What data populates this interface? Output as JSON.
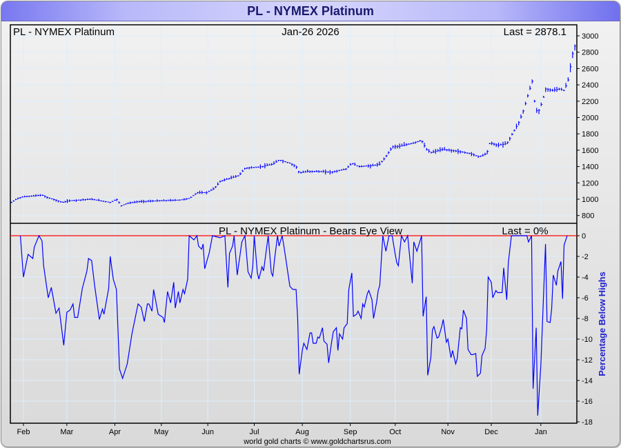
{
  "header": {
    "title": "PL  -  NYMEX Platinum"
  },
  "footer": {
    "credit": "world gold charts © www.goldchartsrus.com"
  },
  "colors": {
    "series": "#0000ff",
    "zero_line": "#ff0000",
    "grid": "#ddeeff",
    "ylabel": "#2222cc"
  },
  "chart_data": [
    {
      "type": "bar",
      "subtype": "ohlc",
      "title": "PL  -  NYMEX Platinum",
      "date_label": "Jan-26  2026",
      "last_label": "Last = 2878.1",
      "x_unit": "days since Feb 1 2025",
      "xlim": [
        -8.5,
        358
      ],
      "ylim": [
        700,
        3100
      ],
      "yticks": [
        800,
        1000,
        1200,
        1400,
        1600,
        1800,
        2000,
        2200,
        2400,
        2600,
        2800,
        3000
      ],
      "grid": true,
      "close_series": [
        [
          -8,
          960
        ],
        [
          -4,
          1010
        ],
        [
          0,
          1030
        ],
        [
          12,
          1050
        ],
        [
          14,
          1030
        ],
        [
          25,
          960
        ],
        [
          29,
          980
        ],
        [
          43,
          1000
        ],
        [
          47,
          990
        ],
        [
          56,
          960
        ],
        [
          60,
          1000
        ],
        [
          63,
          920
        ],
        [
          67,
          950
        ],
        [
          74,
          970
        ],
        [
          87,
          980
        ],
        [
          101,
          990
        ],
        [
          107,
          1010
        ],
        [
          112,
          1080
        ],
        [
          118,
          1080
        ],
        [
          123,
          1130
        ],
        [
          127,
          1220
        ],
        [
          132,
          1250
        ],
        [
          139,
          1290
        ],
        [
          143,
          1380
        ],
        [
          150,
          1390
        ],
        [
          154,
          1400
        ],
        [
          161,
          1430
        ],
        [
          165,
          1480
        ],
        [
          172,
          1440
        ],
        [
          176,
          1400
        ],
        [
          178,
          1320
        ],
        [
          183,
          1340
        ],
        [
          190,
          1340
        ],
        [
          199,
          1330
        ],
        [
          208,
          1370
        ],
        [
          212,
          1440
        ],
        [
          216,
          1400
        ],
        [
          225,
          1410
        ],
        [
          230,
          1430
        ],
        [
          233,
          1500
        ],
        [
          238,
          1640
        ],
        [
          243,
          1650
        ],
        [
          250,
          1680
        ],
        [
          257,
          1720
        ],
        [
          260,
          1610
        ],
        [
          263,
          1570
        ],
        [
          270,
          1610
        ],
        [
          279,
          1590
        ],
        [
          288,
          1560
        ],
        [
          294,
          1520
        ],
        [
          299,
          1560
        ],
        [
          301,
          1690
        ],
        [
          306,
          1660
        ],
        [
          312,
          1680
        ],
        [
          317,
          1850
        ],
        [
          320,
          1950
        ],
        [
          323,
          2100
        ],
        [
          326,
          2300
        ],
        [
          329,
          2480
        ],
        [
          330,
          2150
        ],
        [
          332,
          2050
        ],
        [
          335,
          2200
        ],
        [
          337,
          2350
        ],
        [
          341,
          2330
        ],
        [
          346,
          2350
        ],
        [
          349,
          2330
        ],
        [
          352,
          2480
        ],
        [
          354,
          2750
        ],
        [
          356,
          2878.1
        ]
      ]
    },
    {
      "type": "line",
      "title": "PL  -  NYMEX Platinum - Bears Eye View",
      "last_label": "Last = 0%",
      "ylabel": "Percentage Below Highs",
      "x_unit": "days since Feb 1 2025",
      "xlim": [
        -8.5,
        358
      ],
      "ylim": [
        -18,
        0
      ],
      "yticks": [
        0,
        -2,
        -4,
        -6,
        -8,
        -10,
        -12,
        -14,
        -16,
        -18
      ],
      "grid": true,
      "points": [
        [
          -2,
          0
        ],
        [
          0,
          -4.0
        ],
        [
          3,
          -1.8
        ],
        [
          6,
          -2.2
        ],
        [
          7,
          -1.1
        ],
        [
          10,
          0
        ],
        [
          12,
          -0.5
        ],
        [
          13,
          -2.9
        ],
        [
          16,
          -6.0
        ],
        [
          18,
          -5.0
        ],
        [
          21,
          -7.5
        ],
        [
          23,
          -7.0
        ],
        [
          26,
          -10.6
        ],
        [
          28,
          -7.4
        ],
        [
          30,
          -7.2
        ],
        [
          32,
          -6.6
        ],
        [
          33,
          -7.9
        ],
        [
          35,
          -7.9
        ],
        [
          38,
          -5.1
        ],
        [
          41,
          -3.4
        ],
        [
          42,
          -2.2
        ],
        [
          44,
          -2.4
        ],
        [
          46,
          -4.9
        ],
        [
          49,
          -8.1
        ],
        [
          51,
          -7.1
        ],
        [
          52,
          -7.6
        ],
        [
          55,
          -5.1
        ],
        [
          56,
          -2.0
        ],
        [
          58,
          -4.2
        ],
        [
          60,
          -5.2
        ],
        [
          62,
          -12.9
        ],
        [
          64,
          -13.8
        ],
        [
          67,
          -12.4
        ],
        [
          70,
          -9.5
        ],
        [
          74,
          -6.6
        ],
        [
          76,
          -6.9
        ],
        [
          78,
          -8.3
        ],
        [
          80,
          -6.6
        ],
        [
          81,
          -6.6
        ],
        [
          83,
          -7.3
        ],
        [
          84,
          -5.2
        ],
        [
          87,
          -7.6
        ],
        [
          90,
          -7.9
        ],
        [
          91,
          -8.4
        ],
        [
          93,
          -5.4
        ],
        [
          95,
          -6.5
        ],
        [
          97,
          -4.5
        ],
        [
          98,
          -7.0
        ],
        [
          100,
          -5.4
        ],
        [
          101,
          -6.5
        ],
        [
          103,
          -5.2
        ],
        [
          104,
          -5.6
        ],
        [
          106,
          -4.2
        ],
        [
          107,
          0
        ],
        [
          110,
          -0.4
        ],
        [
          112,
          0
        ],
        [
          113,
          -1.0
        ],
        [
          115,
          -1.3
        ],
        [
          116,
          -0.8
        ],
        [
          117,
          -3.2
        ],
        [
          120,
          -1.6
        ],
        [
          122,
          0
        ],
        [
          127,
          -0.2
        ],
        [
          130,
          0
        ],
        [
          132,
          -5.0
        ],
        [
          133,
          -1.7
        ],
        [
          135,
          -1.0
        ],
        [
          136,
          0
        ],
        [
          138,
          -3.8
        ],
        [
          141,
          -0.6
        ],
        [
          143,
          0
        ],
        [
          145,
          -3.5
        ],
        [
          147,
          -4.1
        ],
        [
          148,
          -3.0
        ],
        [
          149,
          0
        ],
        [
          151,
          -3.6
        ],
        [
          152,
          -4.2
        ],
        [
          154,
          -3.0
        ],
        [
          155,
          -3.4
        ],
        [
          158,
          0
        ],
        [
          160,
          -3.6
        ],
        [
          161,
          -3.9
        ],
        [
          162,
          -2.4
        ],
        [
          164,
          0
        ],
        [
          165,
          -1.0
        ],
        [
          167,
          0
        ],
        [
          168,
          -0.9
        ],
        [
          170,
          -2.9
        ],
        [
          172,
          -4.9
        ],
        [
          174,
          -5.2
        ],
        [
          176,
          -5.2
        ],
        [
          177,
          -8.0
        ],
        [
          178,
          -13.4
        ],
        [
          180,
          -11.1
        ],
        [
          181,
          -10.4
        ],
        [
          183,
          -11.0
        ],
        [
          185,
          -9.4
        ],
        [
          186,
          -9.4
        ],
        [
          187,
          -10.4
        ],
        [
          189,
          -10.4
        ],
        [
          190,
          -9.8
        ],
        [
          191,
          -9.9
        ],
        [
          193,
          -8.9
        ],
        [
          194,
          -10.2
        ],
        [
          196,
          -10.5
        ],
        [
          197,
          -12.3
        ],
        [
          199,
          -10.2
        ],
        [
          200,
          -9.3
        ],
        [
          202,
          -8.9
        ],
        [
          203,
          -11.1
        ],
        [
          204,
          -9.5
        ],
        [
          206,
          -10.0
        ],
        [
          207,
          -8.9
        ],
        [
          209,
          -8.5
        ],
        [
          210,
          -5.2
        ],
        [
          212,
          -3.6
        ],
        [
          213,
          -7.8
        ],
        [
          215,
          -7.6
        ],
        [
          216,
          -7.3
        ],
        [
          218,
          -8.0
        ],
        [
          219,
          -6.6
        ],
        [
          220,
          -6.9
        ],
        [
          222,
          -5.6
        ],
        [
          223,
          -5.3
        ],
        [
          225,
          -6.2
        ],
        [
          226,
          -8.0
        ],
        [
          228,
          -6.4
        ],
        [
          229,
          -5.3
        ],
        [
          230,
          -4.8
        ],
        [
          232,
          0
        ],
        [
          234,
          -1.5
        ],
        [
          236,
          0
        ],
        [
          238,
          0
        ],
        [
          240,
          -1.8
        ],
        [
          241,
          -2.6
        ],
        [
          242,
          -2.9
        ],
        [
          244,
          0
        ],
        [
          246,
          -0.6
        ],
        [
          248,
          0
        ],
        [
          251,
          -4.6
        ],
        [
          252,
          -0.6
        ],
        [
          254,
          -1.5
        ],
        [
          257,
          0
        ],
        [
          258,
          -7.8
        ],
        [
          260,
          -5.9
        ],
        [
          261,
          -13.5
        ],
        [
          263,
          -11.8
        ],
        [
          264,
          -9.1
        ],
        [
          265,
          -8.8
        ],
        [
          267,
          -9.9
        ],
        [
          268,
          -9.8
        ],
        [
          270,
          -8.8
        ],
        [
          271,
          -8.1
        ],
        [
          273,
          -10.3
        ],
        [
          274,
          -10.0
        ],
        [
          276,
          -11.8
        ],
        [
          277,
          -11.1
        ],
        [
          279,
          -12.4
        ],
        [
          280,
          -11.9
        ],
        [
          282,
          -8.9
        ],
        [
          283,
          -9.0
        ],
        [
          284,
          -7.2
        ],
        [
          286,
          -8.0
        ],
        [
          287,
          -11.0
        ],
        [
          289,
          -11.5
        ],
        [
          290,
          -11.5
        ],
        [
          292,
          -11.4
        ],
        [
          293,
          -13.6
        ],
        [
          295,
          -13.3
        ],
        [
          296,
          -11.6
        ],
        [
          298,
          -10.9
        ],
        [
          299,
          -9.1
        ],
        [
          300,
          -4.0
        ],
        [
          302,
          -4.5
        ],
        [
          303,
          -6.0
        ],
        [
          305,
          -5.3
        ],
        [
          306,
          -5.5
        ],
        [
          309,
          -5.5
        ],
        [
          310,
          -3.1
        ],
        [
          312,
          -6.2
        ],
        [
          313,
          -2.6
        ],
        [
          315,
          0
        ],
        [
          325,
          0
        ],
        [
          326,
          -0.6
        ],
        [
          328,
          0
        ],
        [
          329,
          -14.8
        ],
        [
          331,
          -8.9
        ],
        [
          332,
          -17.4
        ],
        [
          334,
          -12.6
        ],
        [
          337,
          -0.8
        ],
        [
          338,
          -8.3
        ],
        [
          340,
          -8.4
        ],
        [
          341,
          -7.1
        ],
        [
          342,
          -3.8
        ],
        [
          344,
          -4.8
        ],
        [
          345,
          -3.4
        ],
        [
          347,
          -2.5
        ],
        [
          348,
          -6.1
        ],
        [
          349,
          -0.9
        ],
        [
          351,
          0
        ]
      ]
    }
  ],
  "x_axis": {
    "months": [
      {
        "label": "Feb",
        "day": 0
      },
      {
        "label": "Mar",
        "day": 28
      },
      {
        "label": "Apr",
        "day": 59
      },
      {
        "label": "May",
        "day": 89
      },
      {
        "label": "Jun",
        "day": 119
      },
      {
        "label": "Jul",
        "day": 149
      },
      {
        "label": "Aug",
        "day": 180
      },
      {
        "label": "Sep",
        "day": 211
      },
      {
        "label": "Oct",
        "day": 240
      },
      {
        "label": "Nov",
        "day": 274
      },
      {
        "label": "Dec",
        "day": 302
      },
      {
        "label": "Jan",
        "day": 334
      }
    ]
  }
}
